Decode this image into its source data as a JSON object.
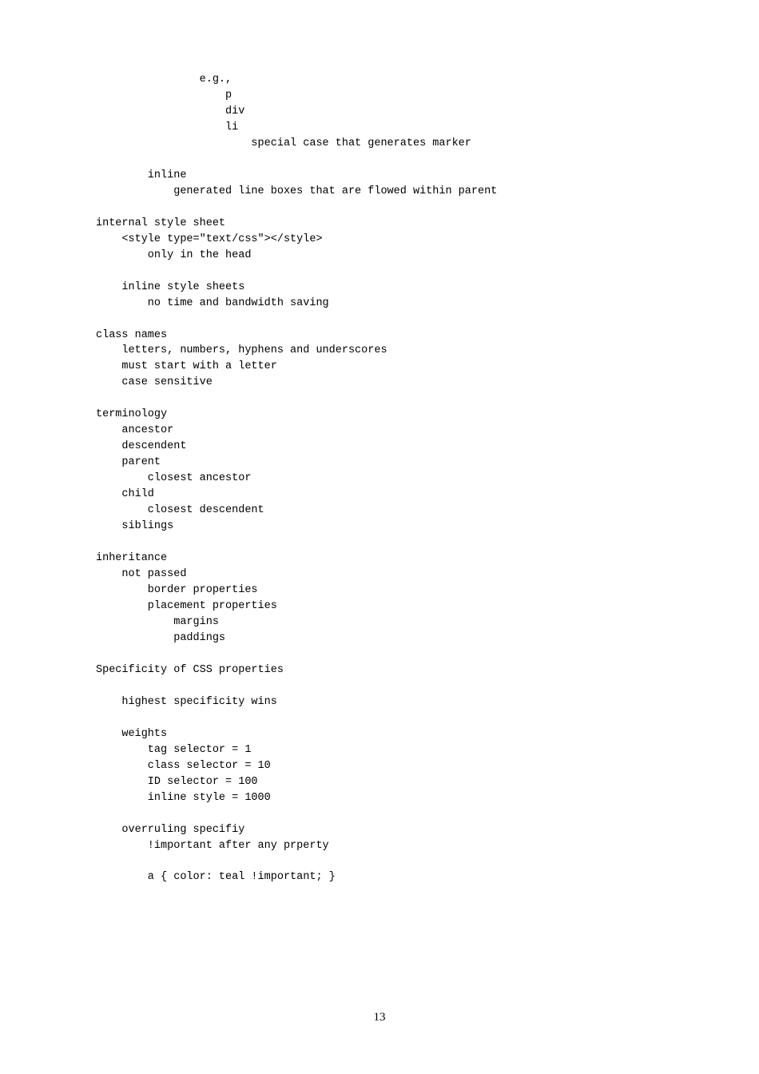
{
  "lines": [
    "                e.g.,",
    "                    p",
    "                    div",
    "                    li",
    "                        special case that generates marker",
    "",
    "        inline",
    "            generated line boxes that are flowed within parent",
    "",
    "internal style sheet",
    "    <style type=\"text/css\"></style>",
    "        only in the head",
    "",
    "    inline style sheets",
    "        no time and bandwidth saving",
    "",
    "class names",
    "    letters, numbers, hyphens and underscores",
    "    must start with a letter",
    "    case sensitive",
    "",
    "terminology",
    "    ancestor",
    "    descendent",
    "    parent",
    "        closest ancestor",
    "    child",
    "        closest descendent",
    "    siblings",
    "",
    "inheritance",
    "    not passed",
    "        border properties",
    "        placement properties",
    "            margins",
    "            paddings",
    "",
    "Specificity of CSS properties",
    "",
    "    highest specificity wins",
    "",
    "    weights",
    "        tag selector = 1",
    "        class selector = 10",
    "        ID selector = 100",
    "        inline style = 1000",
    "",
    "    overruling specifiy",
    "        !important after any prperty",
    "",
    "        a { color: teal !important; }"
  ],
  "page_number": "13"
}
